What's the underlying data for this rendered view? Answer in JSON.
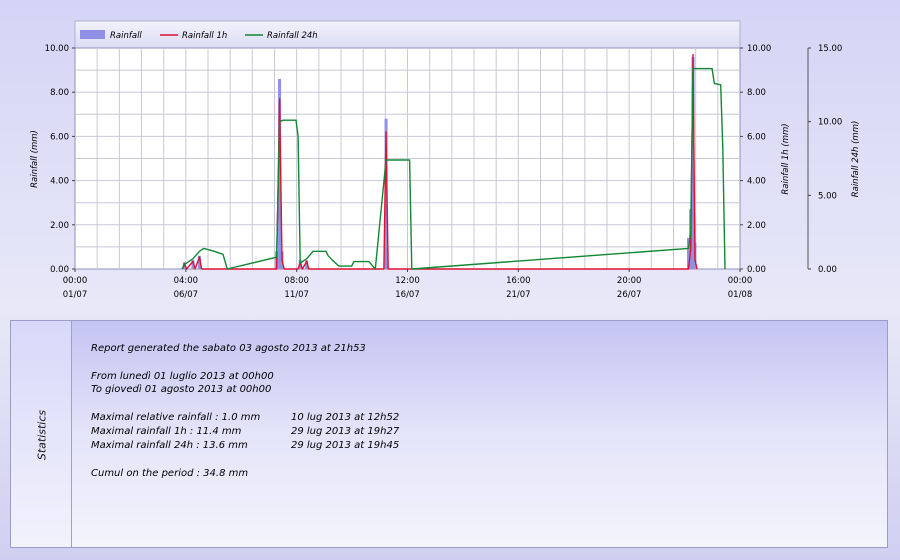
{
  "chart_data": {
    "type": "line",
    "title": "",
    "legend": {
      "placement": "top-left",
      "items": [
        {
          "label": "Rainfall",
          "swatch": "bar",
          "color": "#8f8fe6"
        },
        {
          "label": "Rainfall 1h",
          "swatch": "line",
          "color": "#dd1133"
        },
        {
          "label": "Rainfall 24h",
          "swatch": "line",
          "color": "#118833"
        }
      ]
    },
    "axes": {
      "y_left": {
        "label": "Rainfall (mm)",
        "range": [
          0,
          10
        ],
        "ticks": [
          "0.00",
          "2.00",
          "4.00",
          "6.00",
          "8.00",
          "10.00"
        ]
      },
      "y_right": {
        "label": "Rainfall 1h (mm)",
        "range": [
          0,
          10
        ],
        "ticks": [
          "0.00",
          "2.00",
          "4.00",
          "6.00",
          "8.00",
          "10.00"
        ]
      },
      "y_far_right": {
        "label": "Rainfall 24h (mm)",
        "range": [
          0,
          15
        ],
        "ticks": [
          "0.00",
          "5.00",
          "10.00",
          "15.00"
        ]
      },
      "x": {
        "range": [
          "2013-07-01 00:00",
          "2013-08-01 00:00"
        ],
        "ticks": [
          {
            "time": "00:00",
            "date": "01/07",
            "at": "2013-07-01 00:00"
          },
          {
            "time": "04:00",
            "date": "06/07",
            "at": "2013-07-06 04:00"
          },
          {
            "time": "08:00",
            "date": "11/07",
            "at": "2013-07-11 08:00"
          },
          {
            "time": "12:00",
            "date": "16/07",
            "at": "2013-07-16 12:00"
          },
          {
            "time": "16:00",
            "date": "21/07",
            "at": "2013-07-21 16:00"
          },
          {
            "time": "20:00",
            "date": "26/07",
            "at": "2013-07-26 20:00"
          },
          {
            "time": "00:00",
            "date": "01/08",
            "at": "2013-08-01 00:00"
          }
        ]
      }
    },
    "grid": true,
    "series": [
      {
        "name": "Rainfall",
        "kind": "bar",
        "color": "#8f8fe6",
        "axis": "y_left",
        "points": [
          [
            "2013-07-06 02:24",
            0.3
          ],
          [
            "2013-07-06 12:00",
            0.4
          ],
          [
            "2013-07-06 19:12",
            0.6
          ],
          [
            "2013-07-10 09:36",
            0.8
          ],
          [
            "2013-07-10 12:52",
            8.6
          ],
          [
            "2013-07-10 15:36",
            0.8
          ],
          [
            "2013-07-11 12:00",
            0.4
          ],
          [
            "2013-07-11 19:12",
            0.4
          ],
          [
            "2013-07-15 12:00",
            6.8
          ],
          [
            "2013-07-29 14:24",
            1.4
          ],
          [
            "2013-07-29 16:48",
            2.7
          ],
          [
            "2013-07-29 19:27",
            9.6
          ],
          [
            "2013-07-29 21:36",
            1.2
          ]
        ]
      },
      {
        "name": "Rainfall 1h",
        "kind": "line",
        "color": "#dd1133",
        "axis": "y_right",
        "points": [
          [
            "2013-07-06 00:00",
            0
          ],
          [
            "2013-07-06 02:24",
            0.25
          ],
          [
            "2013-07-06 04:48",
            0
          ],
          [
            "2013-07-06 12:00",
            0.35
          ],
          [
            "2013-07-06 14:24",
            0
          ],
          [
            "2013-07-06 19:12",
            0.55
          ],
          [
            "2013-07-06 21:36",
            0
          ],
          [
            "2013-07-10 09:36",
            0
          ],
          [
            "2013-07-10 12:52",
            7.7
          ],
          [
            "2013-07-10 15:36",
            0.4
          ],
          [
            "2013-07-10 18:00",
            0
          ],
          [
            "2013-07-11 09:36",
            0
          ],
          [
            "2013-07-11 12:00",
            0.3
          ],
          [
            "2013-07-11 14:24",
            0
          ],
          [
            "2013-07-11 19:12",
            0.35
          ],
          [
            "2013-07-11 21:36",
            0
          ],
          [
            "2013-07-15 09:36",
            0
          ],
          [
            "2013-07-15 12:00",
            6.2
          ],
          [
            "2013-07-15 14:24",
            0
          ],
          [
            "2013-07-29 14:24",
            0
          ],
          [
            "2013-07-29 16:48",
            0.9
          ],
          [
            "2013-07-29 19:27",
            9.7
          ],
          [
            "2013-07-29 21:36",
            0.4
          ],
          [
            "2013-07-30 00:00",
            0
          ]
        ]
      },
      {
        "name": "Rainfall 24h",
        "kind": "line",
        "color": "#118833",
        "axis": "y_far_right",
        "points": [
          [
            "2013-07-06 00:00",
            0
          ],
          [
            "2013-07-06 02:24",
            0.3
          ],
          [
            "2013-07-06 12:00",
            0.7
          ],
          [
            "2013-07-06 19:12",
            1.2
          ],
          [
            "2013-07-07 00:00",
            1.4
          ],
          [
            "2013-07-07 12:00",
            1.2
          ],
          [
            "2013-07-07 21:36",
            1.0
          ],
          [
            "2013-07-08 02:24",
            0
          ],
          [
            "2013-07-10 09:36",
            0.8
          ],
          [
            "2013-07-10 12:52",
            10.0
          ],
          [
            "2013-07-10 16:48",
            10.1
          ],
          [
            "2013-07-11 07:12",
            10.1
          ],
          [
            "2013-07-11 09:36",
            9.0
          ],
          [
            "2013-07-11 12:00",
            0.4
          ],
          [
            "2013-07-11 19:12",
            0.7
          ],
          [
            "2013-07-12 02:24",
            1.2
          ],
          [
            "2013-07-12 16:48",
            1.2
          ],
          [
            "2013-07-12 19:12",
            0.9
          ],
          [
            "2013-07-13 00:00",
            0.6
          ],
          [
            "2013-07-13 07:12",
            0.2
          ],
          [
            "2013-07-13 21:36",
            0.2
          ],
          [
            "2013-07-14 00:00",
            0.5
          ],
          [
            "2013-07-14 16:48",
            0.5
          ],
          [
            "2013-07-15 00:00",
            0
          ],
          [
            "2013-07-15 12:00",
            7.4
          ],
          [
            "2013-07-16 14:24",
            7.4
          ],
          [
            "2013-07-16 16:48",
            0
          ],
          [
            "2013-07-29 14:24",
            1.4
          ],
          [
            "2013-07-29 16:48",
            2.5
          ],
          [
            "2013-07-29 19:27",
            13.6
          ],
          [
            "2013-07-30 16:48",
            13.6
          ],
          [
            "2013-07-30 19:12",
            12.6
          ],
          [
            "2013-07-31 02:24",
            12.5
          ],
          [
            "2013-07-31 04:48",
            8.2
          ],
          [
            "2013-07-31 07:12",
            0
          ]
        ]
      }
    ]
  },
  "stats": {
    "label": "Statistics",
    "report": "Report generated the sabato 03 agosto 2013 at 21h53",
    "from": "From lunedì 01 luglio 2013 at 00h00",
    "to": "To giovedì 01 agosto 2013 at 00h00",
    "max_relative": {
      "label": "Maximal relative rainfall : 1.0 mm",
      "when": "10 lug 2013 at 12h52"
    },
    "max_1h": {
      "label": "Maximal rainfall 1h  : 11.4 mm",
      "when": "29 lug 2013 at 19h27"
    },
    "max_24h": {
      "label": "Maximal rainfall 24h : 13.6 mm",
      "when": "29 lug 2013 at 19h45"
    },
    "cumul": "Cumul on the period : 34.8 mm"
  }
}
